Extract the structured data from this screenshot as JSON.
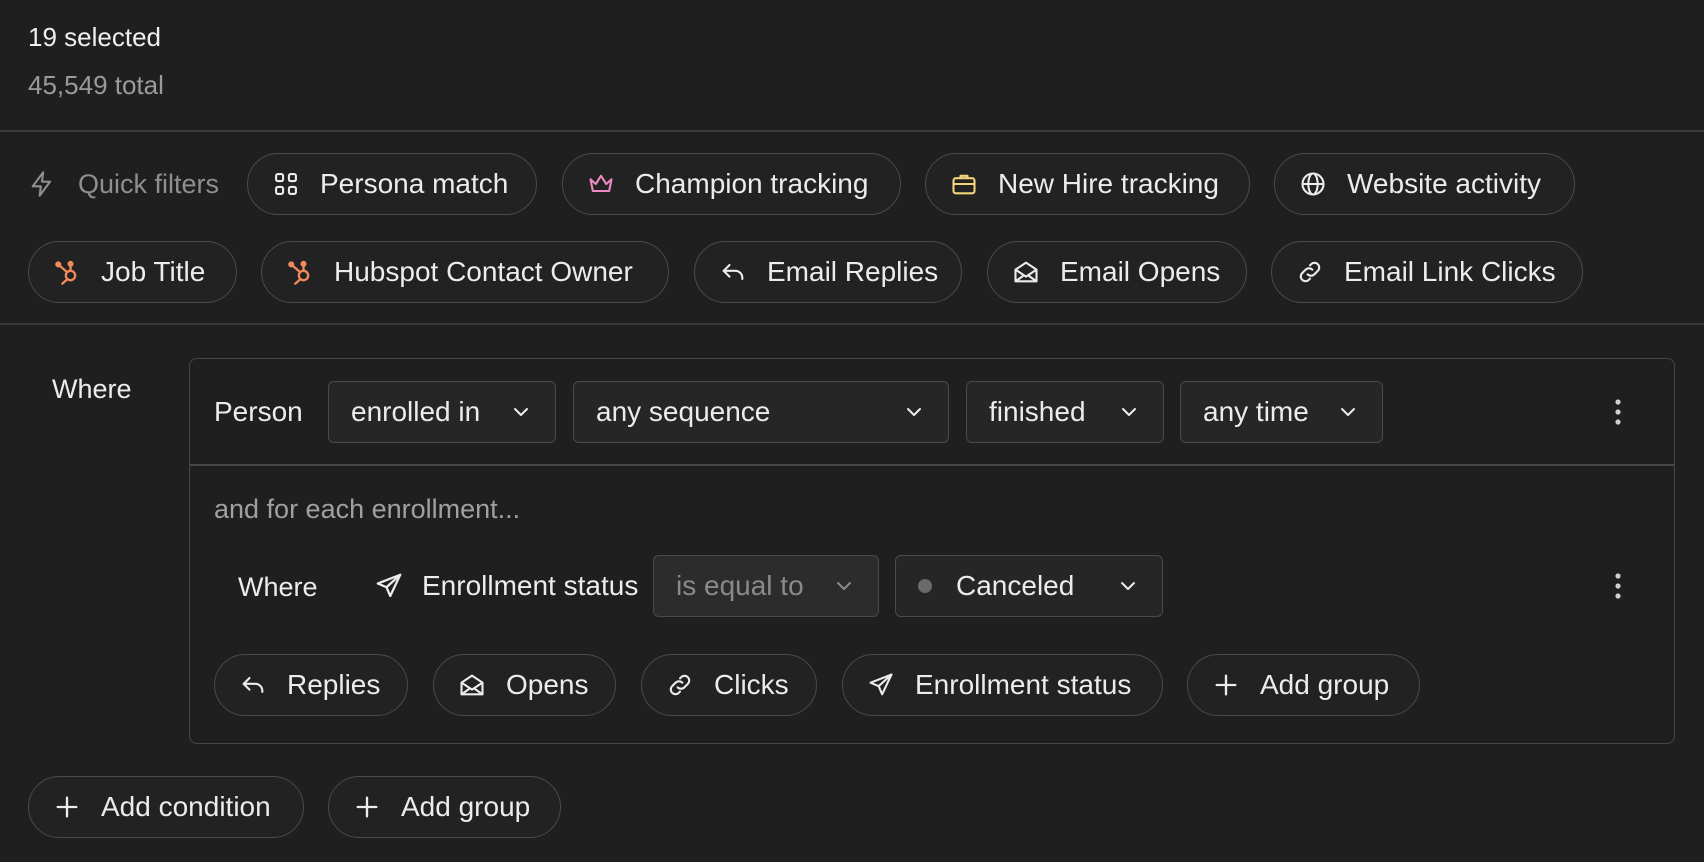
{
  "header": {
    "selected": "19 selected",
    "total": "45,549 total"
  },
  "quick_filters": {
    "label": "Quick filters",
    "row1": [
      {
        "label": "Persona match",
        "icon": "grid-icon"
      },
      {
        "label": "Champion tracking",
        "icon": "crown-icon",
        "icon_color": "#e98bc2"
      },
      {
        "label": "New Hire tracking",
        "icon": "briefcase-icon",
        "icon_color": "#f2d47a"
      },
      {
        "label": "Website activity",
        "icon": "globe-icon"
      }
    ],
    "row2": [
      {
        "label": "Job Title",
        "icon": "hubspot-icon",
        "icon_color": "#f08a5d"
      },
      {
        "label": "Hubspot Contact Owner",
        "icon": "hubspot-icon",
        "icon_color": "#f08a5d"
      },
      {
        "label": "Email Replies",
        "icon": "reply-icon"
      },
      {
        "label": "Email Opens",
        "icon": "envelope-open-icon"
      },
      {
        "label": "Email Link Clicks",
        "icon": "link-icon"
      }
    ]
  },
  "filter": {
    "where_label": "Where",
    "subject": "Person",
    "selects": [
      {
        "value": "enrolled in"
      },
      {
        "value": "any sequence"
      },
      {
        "value": "finished"
      },
      {
        "value": "any time"
      }
    ],
    "sub": {
      "note": "and for each enrollment...",
      "where_label": "Where",
      "field": "Enrollment status",
      "operator": "is equal to",
      "value": "Canceled"
    },
    "sub_buttons": [
      {
        "label": "Replies",
        "icon": "reply-icon"
      },
      {
        "label": "Opens",
        "icon": "envelope-open-icon"
      },
      {
        "label": "Clicks",
        "icon": "link-icon"
      },
      {
        "label": "Enrollment status",
        "icon": "send-icon"
      },
      {
        "label": "Add group",
        "icon": "plus-icon"
      }
    ]
  },
  "footer_buttons": [
    {
      "label": "Add condition",
      "icon": "plus-icon"
    },
    {
      "label": "Add group",
      "icon": "plus-icon"
    }
  ]
}
